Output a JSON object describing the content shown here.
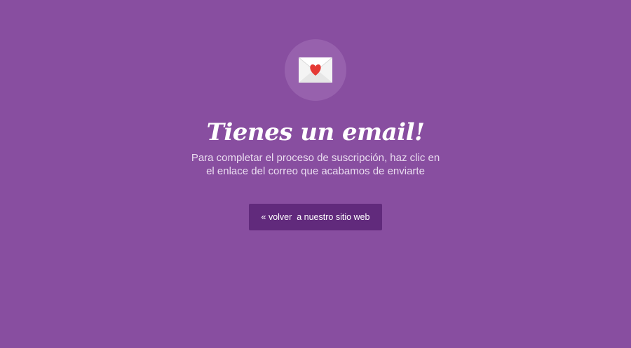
{
  "colors": {
    "background": "#884ea0",
    "icon_circle": "#9761ad",
    "button": "#612a7c",
    "heart": "#e53935",
    "envelope": "#f4f4f4"
  },
  "hero": {
    "icon": "envelope-heart-icon",
    "title": "Tienes un email!",
    "subtitle": "Para completar el proceso de suscripción, haz clic en el enlace del correo que acabamos de enviarte"
  },
  "actions": {
    "back_label": "« volver  a nuestro sitio web"
  }
}
